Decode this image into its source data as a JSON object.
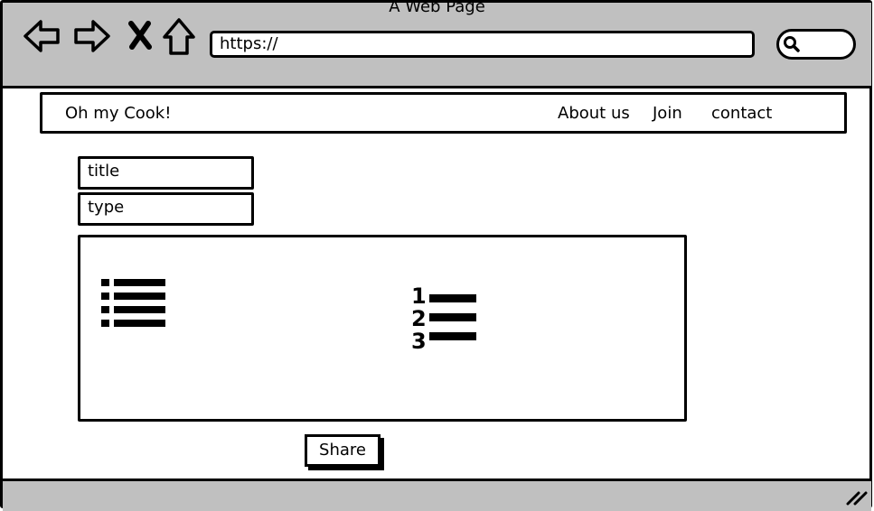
{
  "window": {
    "title": "A Web Page"
  },
  "browser": {
    "url": "https://",
    "icons": [
      "back-icon",
      "forward-icon",
      "close-icon",
      "home-icon",
      "search-icon"
    ]
  },
  "navbar": {
    "brand": "Oh my Cook!",
    "links": [
      "About us",
      "Join",
      "contact"
    ]
  },
  "form": {
    "title_label": "title",
    "type_label": "type",
    "editor_icons": [
      "bulleted-list-icon",
      "numbered-list-icon"
    ],
    "share_label": "Share"
  },
  "colors": {
    "chrome": "#c0c0c0",
    "ink": "#000000",
    "page": "#ffffff"
  }
}
